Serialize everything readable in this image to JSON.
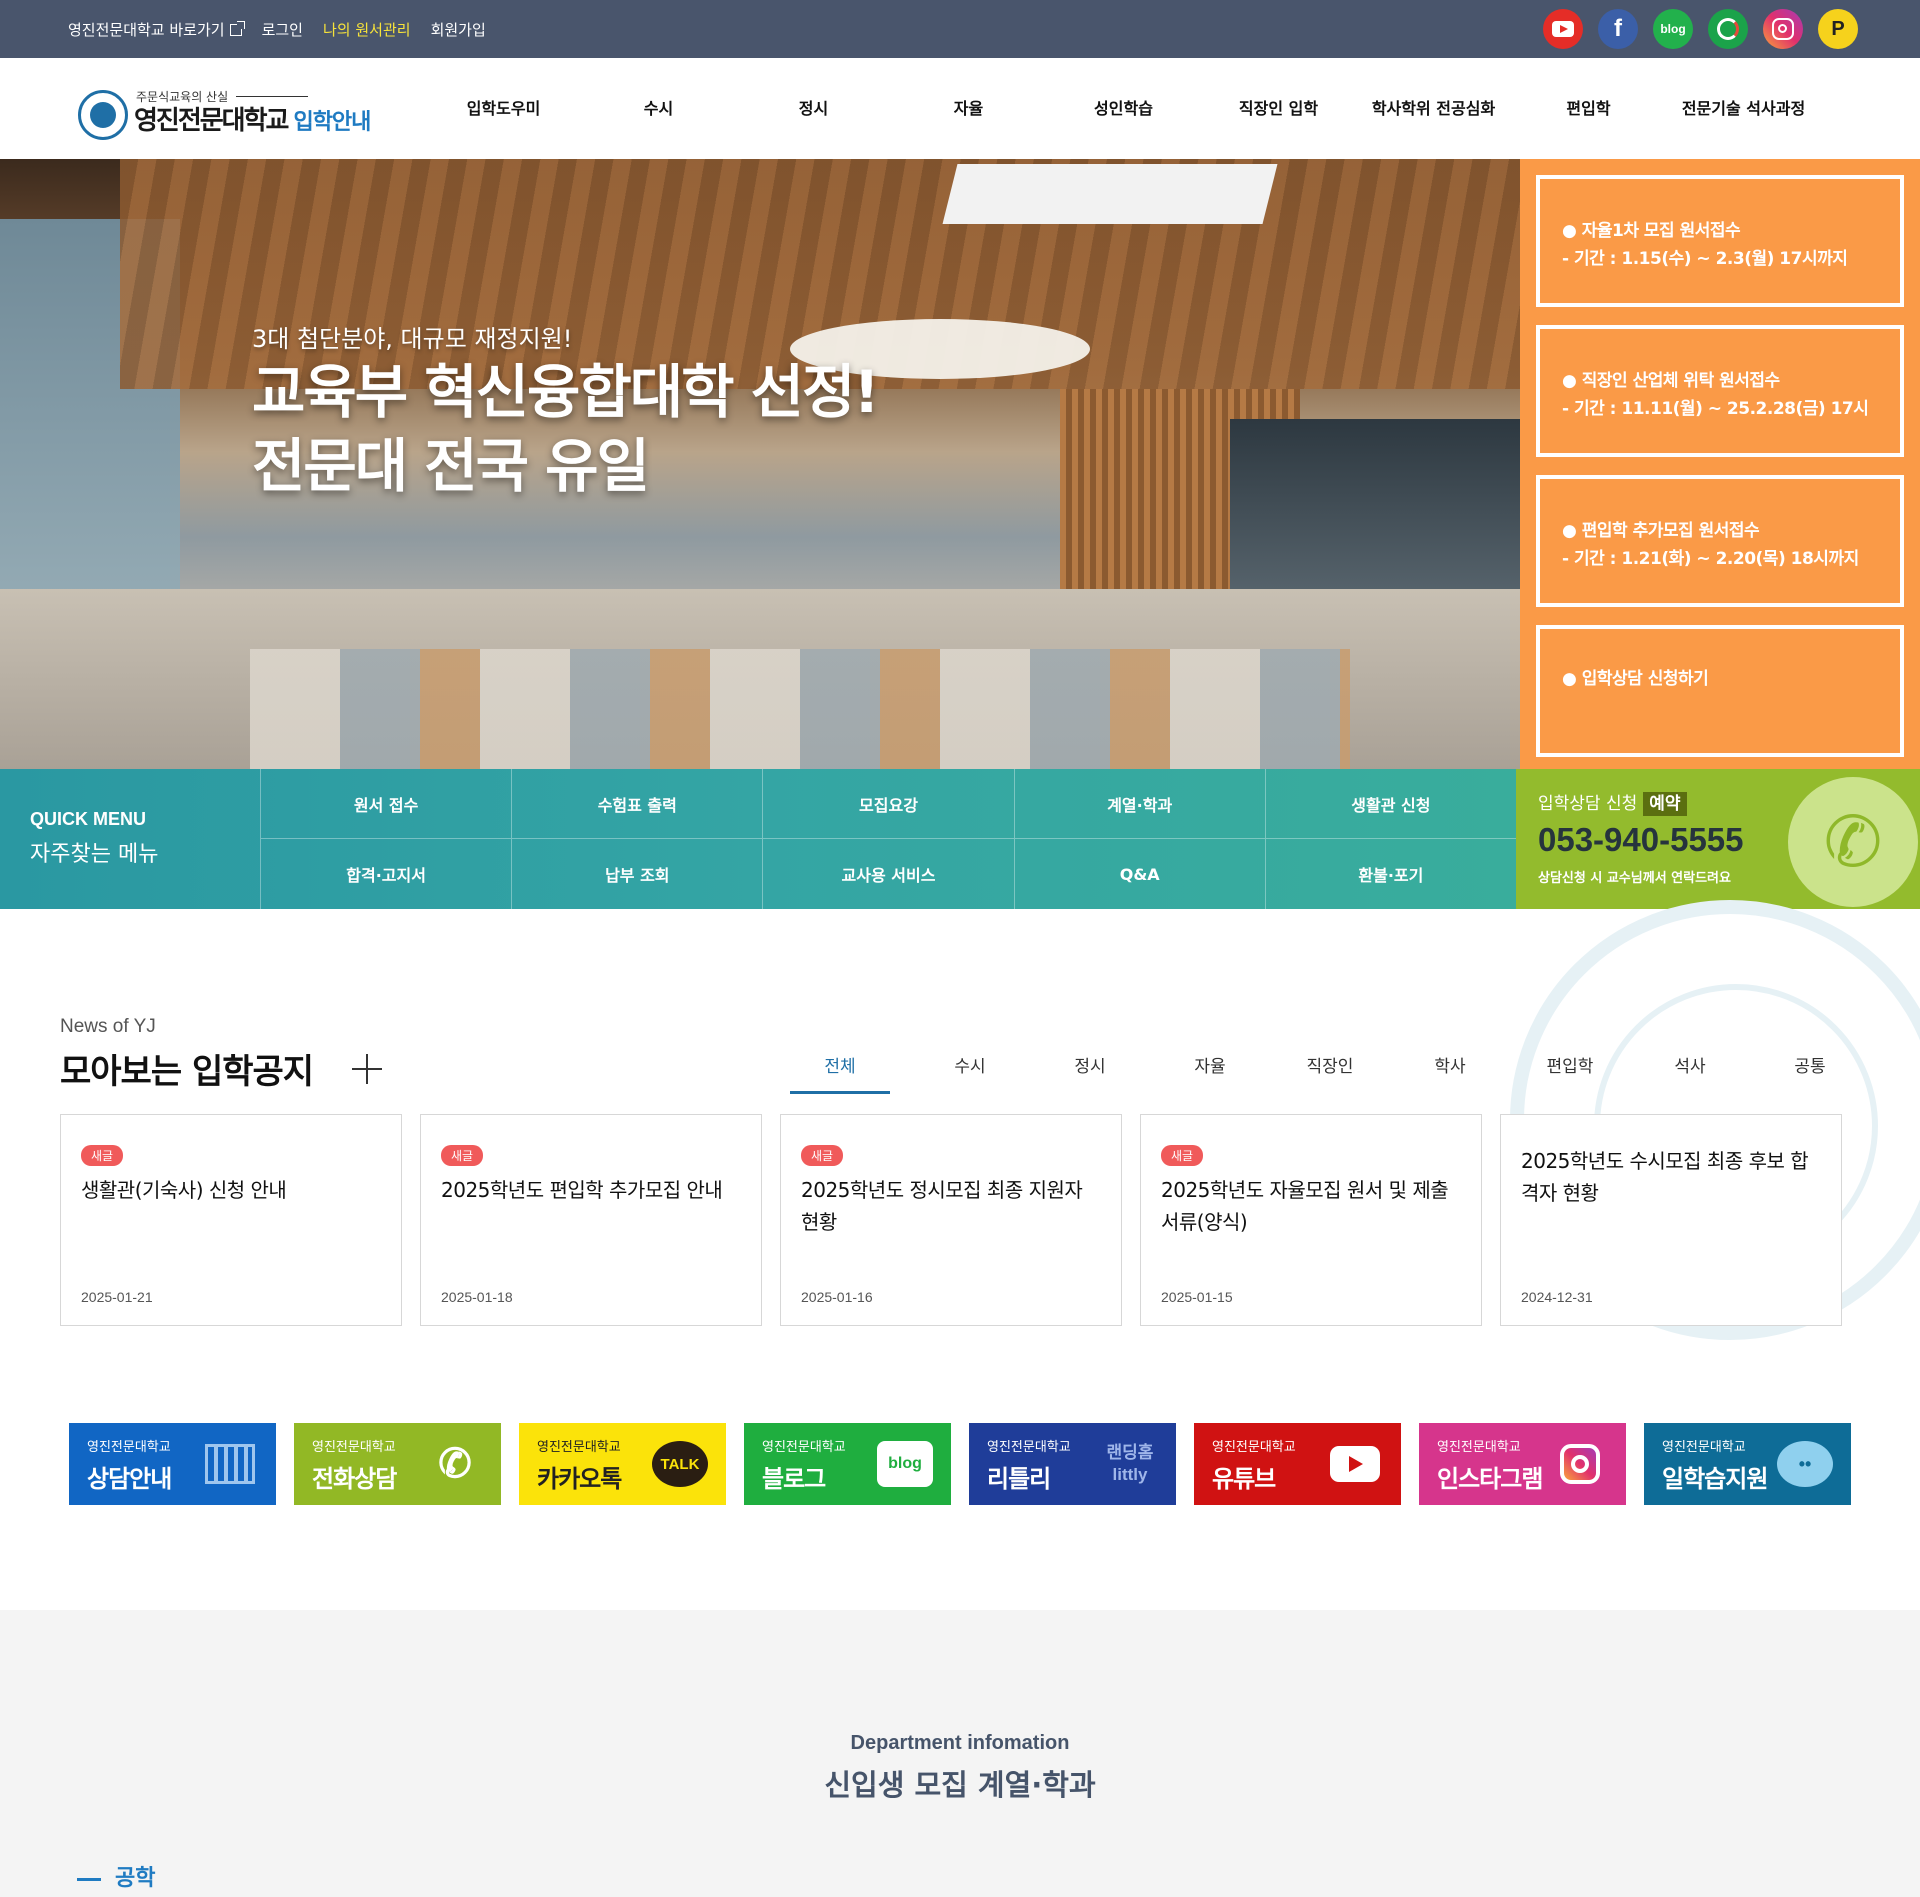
{
  "topbar": {
    "links": [
      "영진전문대학교 바로가기",
      "로그인",
      "나의 원서관리",
      "회원가입"
    ],
    "social_icons": [
      "youtube-icon",
      "facebook-icon",
      "blog-icon",
      "green-circle-icon",
      "instagram-icon",
      "pay-icon"
    ],
    "social_labels": [
      "f",
      "blog",
      "P"
    ],
    "highlight_color": "#f6e23a",
    "bar_color": "#49556c"
  },
  "logo": {
    "tagline": "주문식교육의 산실",
    "name": "영진전문대학교",
    "suffix": "입학안내"
  },
  "gnb": [
    "입학도우미",
    "수시",
    "정시",
    "자율",
    "성인학습",
    "직장인 입학",
    "학사학위 전공심화",
    "편입학",
    "전문기술 석사과정"
  ],
  "hero": {
    "subtitle": "3대 첨단분야, 대규모 재정지원!",
    "title_line1": "교육부 혁신융합대학 선정!",
    "title_line2": "전문대 전국 유일"
  },
  "notices": [
    {
      "title": "● 자율1차 모집 원서접수",
      "period": "- 기간 : 1.15(수) ~ 2.3(월) 17시까지"
    },
    {
      "title": "● 직장인 산업체 위탁 원서접수",
      "period": "- 기간 : 11.11(월) ~ 25.2.28(금) 17시"
    },
    {
      "title": "● 편입학 추가모집 원서접수",
      "period": "- 기간 : 1.21(화) ~ 2.20(목) 18시까지"
    },
    {
      "title": "● 입학상담 신청하기",
      "period": ""
    }
  ],
  "quick_menu": {
    "title_en": "QUICK MENU",
    "title_ko": "자주찾는 메뉴",
    "items": [
      "원서 접수",
      "수험표 출력",
      "모집요강",
      "계열·학과",
      "생활관 신청",
      "합격·고지서",
      "납부 조회",
      "교사용 서비스",
      "Q&A",
      "환불·포기"
    ]
  },
  "consult": {
    "label": "입학상담 신청",
    "badge": "예약",
    "phone": "053-940-5555",
    "note": "상담신청 시 교수님께서 연락드려요",
    "phone_glyph": "✆"
  },
  "news": {
    "title_en": "News of YJ",
    "title": "모아보는 입학공지",
    "tabs": [
      "전체",
      "수시",
      "정시",
      "자율",
      "직장인",
      "학사",
      "편입학",
      "석사",
      "공통"
    ],
    "active_tab": "전체",
    "cards": [
      {
        "badge": "새글",
        "title": "생활관(기숙사) 신청 안내",
        "date": "2025-01-21"
      },
      {
        "badge": "새글",
        "title": "2025학년도 편입학 추가모집 안내",
        "date": "2025-01-18"
      },
      {
        "badge": "새글",
        "title": "2025학년도 정시모집 최종 지원자 현황",
        "date": "2025-01-16"
      },
      {
        "badge": "새글",
        "title": "2025학년도 자율모집 원서 및 제출서류(양식)",
        "date": "2025-01-15"
      },
      {
        "badge": "",
        "title": "2025학년도 수시모집 최종 후보 합격자 현황",
        "date": "2024-12-31"
      }
    ]
  },
  "banners": [
    {
      "small": "영진전문대학교",
      "big": "상담안내",
      "icon": "building-icon",
      "icon_text": ""
    },
    {
      "small": "영진전문대학교",
      "big": "전화상담",
      "icon": "phone-icon",
      "icon_text": "✆"
    },
    {
      "small": "영진전문대학교",
      "big": "카카오톡",
      "icon": "kakaotalk-icon",
      "icon_text": "TALK"
    },
    {
      "small": "영진전문대학교",
      "big": "블로그",
      "icon": "blog-icon",
      "icon_text": "blog"
    },
    {
      "small": "영진전문대학교",
      "big": "리틀리",
      "icon": "littly-icon",
      "icon_text": "랜딩홈",
      "icon_text2": "littly"
    },
    {
      "small": "영진전문대학교",
      "big": "유튜브",
      "icon": "youtube-icon",
      "icon_text": ""
    },
    {
      "small": "영진전문대학교",
      "big": "인스타그램",
      "icon": "instagram-icon",
      "icon_text": ""
    },
    {
      "small": "영진전문대학교",
      "big": "일학습지원",
      "icon": "chat-icon",
      "icon_text": "••"
    }
  ],
  "department": {
    "title_en": "Department infomation",
    "title": "신입생 모집 계열·학과",
    "category": "공학"
  },
  "colors": {
    "notice_orange": "#fa9a47",
    "quick_teal": "#34a5a4",
    "consult_green": "#93bb2d",
    "accent_blue": "#1f6fa6",
    "badge_red": "#f05a5a"
  }
}
